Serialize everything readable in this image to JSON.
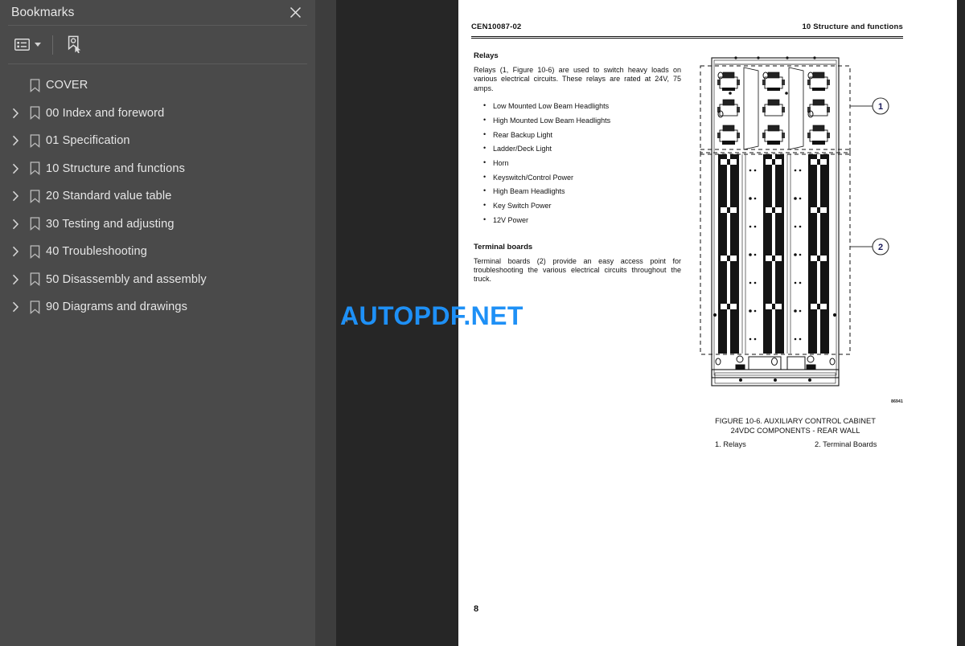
{
  "sidebar": {
    "title": "Bookmarks",
    "close_icon": "close-icon",
    "toolbar": {
      "options_icon": "bookmark-options-icon",
      "caret_icon": "chevron-down-icon",
      "new_bookmark_icon": "new-bookmark-icon"
    },
    "items": [
      {
        "label": "COVER",
        "expandable": false
      },
      {
        "label": "00 Index and foreword",
        "expandable": true
      },
      {
        "label": "01 Specification",
        "expandable": true
      },
      {
        "label": "10 Structure and functions",
        "expandable": true
      },
      {
        "label": "20 Standard value table",
        "expandable": true
      },
      {
        "label": "30 Testing and adjusting",
        "expandable": true
      },
      {
        "label": "40 Troubleshooting",
        "expandable": true
      },
      {
        "label": "50 Disassembly and assembly",
        "expandable": true
      },
      {
        "label": "90 Diagrams and drawings",
        "expandable": true
      }
    ]
  },
  "viewer": {
    "collapse_icon": "collapse-left-icon",
    "watermark": "AUTOPDF.NET",
    "watermark_color": "#1e90f6"
  },
  "document": {
    "header": {
      "code": "CEN10087-02",
      "section": "10 Structure and functions"
    },
    "page_number": "8",
    "sections": [
      {
        "heading": "Relays",
        "paragraph": "Relays (1, Figure 10-6) are used to switch heavy loads on various electrical circuits. These relays are rated at 24V, 75 amps.",
        "bullets": [
          "Low Mounted Low Beam Headlights",
          "High Mounted Low Beam Headlights",
          "Rear Backup Light",
          "Ladder/Deck Light",
          "Horn",
          "Keyswitch/Control Power",
          "High Beam Headlights",
          "Key Switch Power",
          "12V Power"
        ]
      },
      {
        "heading": "Terminal boards",
        "paragraph": "Terminal boards (2) provide an easy access point for troubleshooting the various electrical circuits throughout the truck."
      }
    ],
    "figure": {
      "id_code": "86941",
      "caption_line1": "FIGURE 10-6. AUXILIARY CONTROL CABINET",
      "caption_line2": "24VDC COMPONENTS - REAR WALL",
      "legend": [
        "1. Relays",
        "2. Terminal Boards"
      ],
      "callouts": [
        {
          "number": "1"
        },
        {
          "number": "2"
        }
      ]
    }
  }
}
